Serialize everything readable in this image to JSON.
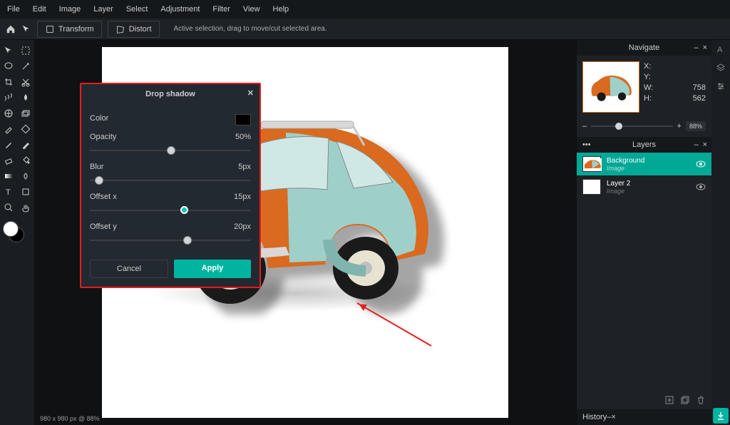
{
  "menu": [
    "File",
    "Edit",
    "Image",
    "Layer",
    "Select",
    "Adjustment",
    "Filter",
    "View",
    "Help"
  ],
  "toolbar": {
    "transform": "Transform",
    "distort": "Distort",
    "hint": "Active selection, drag to move/cut selected area."
  },
  "dialog": {
    "title": "Drop shadow",
    "color_label": "Color",
    "opacity_label": "Opacity",
    "opacity_value": "50%",
    "blur_label": "Blur",
    "blur_value": "5px",
    "offx_label": "Offset x",
    "offx_value": "15px",
    "offy_label": "Offset y",
    "offy_value": "20px",
    "cancel": "Cancel",
    "apply": "Apply"
  },
  "status": "980 x 980 px @ 88%",
  "navigate": {
    "title": "Navigate",
    "x": "X:",
    "y": "Y:",
    "w": "W:",
    "wv": "758",
    "h": "H:",
    "hv": "562",
    "zoom": "88%"
  },
  "layers": {
    "title": "Layers",
    "items": [
      {
        "name": "Background",
        "type": "Image"
      },
      {
        "name": "Layer 2",
        "type": "Image"
      }
    ]
  },
  "history": "History"
}
